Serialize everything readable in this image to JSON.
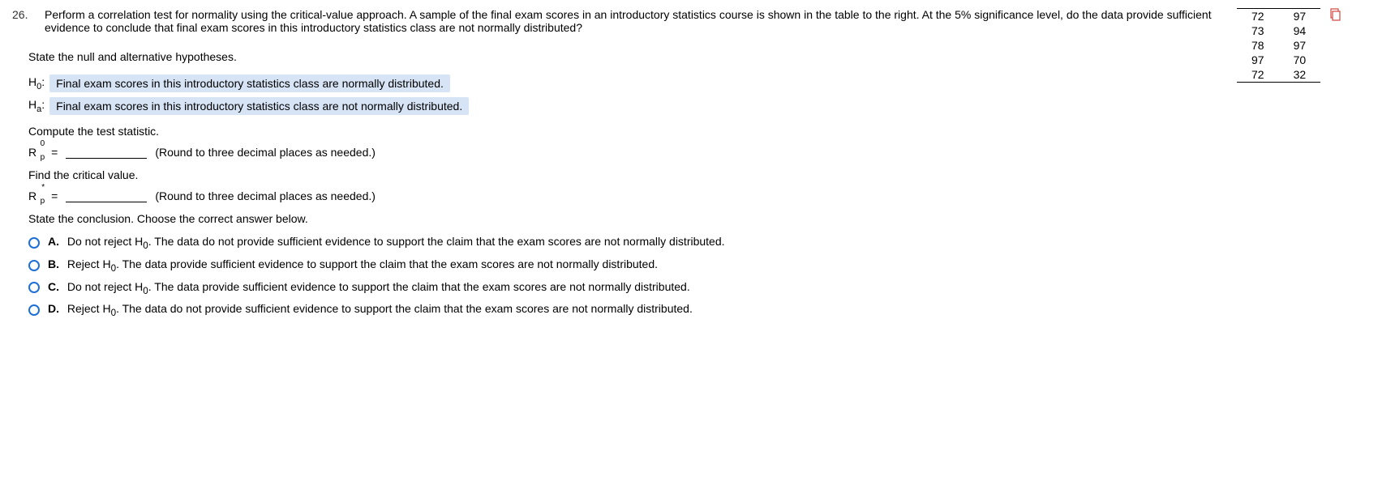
{
  "question": {
    "number": "26.",
    "text": "Perform a correlation test for normality using the critical-value approach. A sample of the final exam scores in an introductory statistics course is shown in the table to the right. At the 5% significance level, do the data provide sufficient evidence to conclude that final exam scores in this introductory statistics class are not normally distributed?"
  },
  "data_table": {
    "rows": [
      [
        "72",
        "97"
      ],
      [
        "73",
        "94"
      ],
      [
        "78",
        "97"
      ],
      [
        "97",
        "70"
      ],
      [
        "72",
        "32"
      ]
    ]
  },
  "hypotheses": {
    "heading": "State the null and alternative hypotheses.",
    "h0_label": "H",
    "h0_sub": "0",
    "h0_text": "Final exam scores in this introductory statistics class are normally distributed.",
    "ha_label": "H",
    "ha_sub": "a",
    "ha_text": "Final exam scores in this introductory statistics class are not normally distributed."
  },
  "test_stat": {
    "heading": "Compute the test statistic.",
    "symbol": "R",
    "sup": "0",
    "sub": "p",
    "equals": "=",
    "hint": "(Round to three decimal places as needed.)"
  },
  "critical": {
    "heading": "Find the critical value.",
    "symbol": "R",
    "sup": "*",
    "sub": "p",
    "equals": "=",
    "hint": "(Round to three decimal places as needed.)"
  },
  "conclusion": {
    "heading": "State the conclusion. Choose the correct answer below.",
    "choices": [
      {
        "label": "A.",
        "text_before": "Do not reject H",
        "sub": "0",
        "text_after": ". The data do not provide sufficient evidence to support the claim that the exam scores are not normally distributed."
      },
      {
        "label": "B.",
        "text_before": "Reject H",
        "sub": "0",
        "text_after": ". The data provide sufficient evidence to support the claim that the exam scores are not normally distributed."
      },
      {
        "label": "C.",
        "text_before": "Do not reject H",
        "sub": "0",
        "text_after": ". The data provide sufficient evidence to support the claim that the exam scores are not normally distributed."
      },
      {
        "label": "D.",
        "text_before": "Reject H",
        "sub": "0",
        "text_after": ". The data do not provide sufficient evidence to support the claim that the exam scores are not normally distributed."
      }
    ]
  }
}
